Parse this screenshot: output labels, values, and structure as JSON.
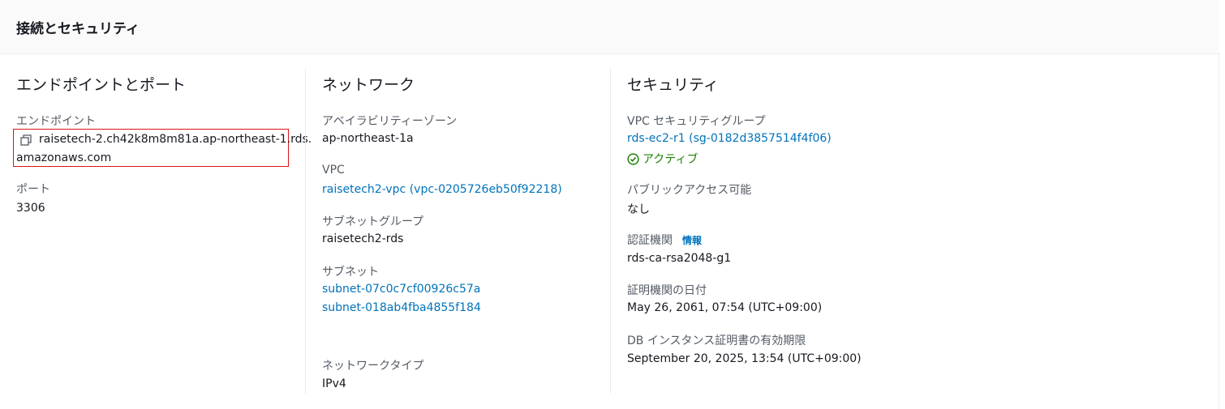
{
  "panel": {
    "title": "接続とセキュリティ"
  },
  "endpoint_section": {
    "heading": "エンドポイントとポート",
    "endpoint_label": "エンドポイント",
    "endpoint_line1": "raisetech-2.ch42k8m8m81a.ap-northeast-1.rds.",
    "endpoint_line2": "amazonaws.com",
    "port_label": "ポート",
    "port_value": "3306"
  },
  "network_section": {
    "heading": "ネットワーク",
    "az_label": "アベイラビリティーゾーン",
    "az_value": "ap-northeast-1a",
    "vpc_label": "VPC",
    "vpc_value": "raisetech2-vpc (vpc-0205726eb50f92218)",
    "subnet_group_label": "サブネットグループ",
    "subnet_group_value": "raisetech2-rds",
    "subnets_label": "サブネット",
    "subnets": [
      "subnet-07c0c7cf00926c57a",
      "subnet-018ab4fba4855f184"
    ],
    "network_type_label": "ネットワークタイプ",
    "network_type_value": "IPv4"
  },
  "security_section": {
    "heading": "セキュリティ",
    "sg_label": "VPC セキュリティグループ",
    "sg_value": "rds-ec2-r1 (sg-0182d3857514f4f06)",
    "sg_status": "アクティブ",
    "public_access_label": "パブリックアクセス可能",
    "public_access_value": "なし",
    "ca_label": "認証機関",
    "ca_info": "情報",
    "ca_value": "rds-ca-rsa2048-g1",
    "ca_date_label": "証明機関の日付",
    "ca_date_value": "May 26, 2061, 07:54 (UTC+09:00)",
    "cert_expiry_label": "DB インスタンス証明書の有効期限",
    "cert_expiry_value": "September 20, 2025, 13:54 (UTC+09:00)"
  },
  "colors": {
    "link": "#0073bb",
    "status_active": "#1d8102",
    "highlight_border": "#d91515",
    "label": "#545b64",
    "text": "#16191f"
  },
  "icons": {
    "copy": "copy-icon",
    "status": "check-circle-icon"
  }
}
